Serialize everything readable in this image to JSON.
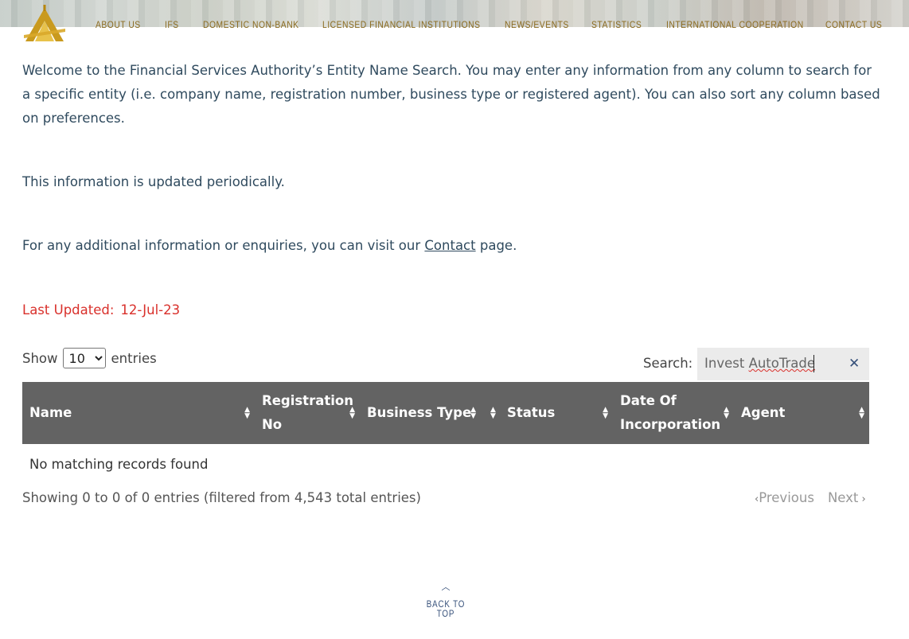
{
  "nav": {
    "items": [
      "ABOUT US",
      "IFS",
      "DOMESTIC NON-BANK",
      "LICENSED FINANCIAL INSTITUTIONS",
      "NEWS/EVENTS",
      "STATISTICS",
      "INTERNATIONAL COOPERATION",
      "CONTACT US"
    ]
  },
  "intro": {
    "p1": "Welcome to the Financial Services Authority’s Entity Name Search. You may enter any information from any column to search for a specific entity (i.e. company name, registration number, business type or registered agent). You can also sort any column based on preferences.",
    "p2": "This information is updated periodically.",
    "p3_before": "For any additional information or enquiries, you can visit our ",
    "p3_link": "Contact",
    "p3_after": " page.",
    "updated_label": "Last Updated:",
    "updated_date": "12-Jul-23"
  },
  "controls": {
    "show_label": "Show",
    "entries_label": "entries",
    "page_size": "10",
    "search_label": "Search:",
    "search_value_1": "Invest ",
    "search_value_2": "AutoTrade"
  },
  "table": {
    "columns": [
      {
        "l1": "Name",
        "l2": ""
      },
      {
        "l1": "Registration",
        "l2": "No"
      },
      {
        "l1": "Business Type",
        "l2": ""
      },
      {
        "l1": "Status",
        "l2": ""
      },
      {
        "l1": "Date Of",
        "l2": "Incorporation"
      },
      {
        "l1": "Agent",
        "l2": ""
      }
    ],
    "empty_message": "No matching records found"
  },
  "footer": {
    "info": "Showing 0 to 0 of 0 entries (filtered from 4,543 total entries)",
    "previous": "Previous",
    "next": "Next",
    "back_to_top": "BACK TO TOP"
  },
  "colors": {
    "nav_text": "#8a6a1f",
    "body_text": "#2f4a5e",
    "updated": "#d9302b",
    "table_header": "#636363"
  }
}
